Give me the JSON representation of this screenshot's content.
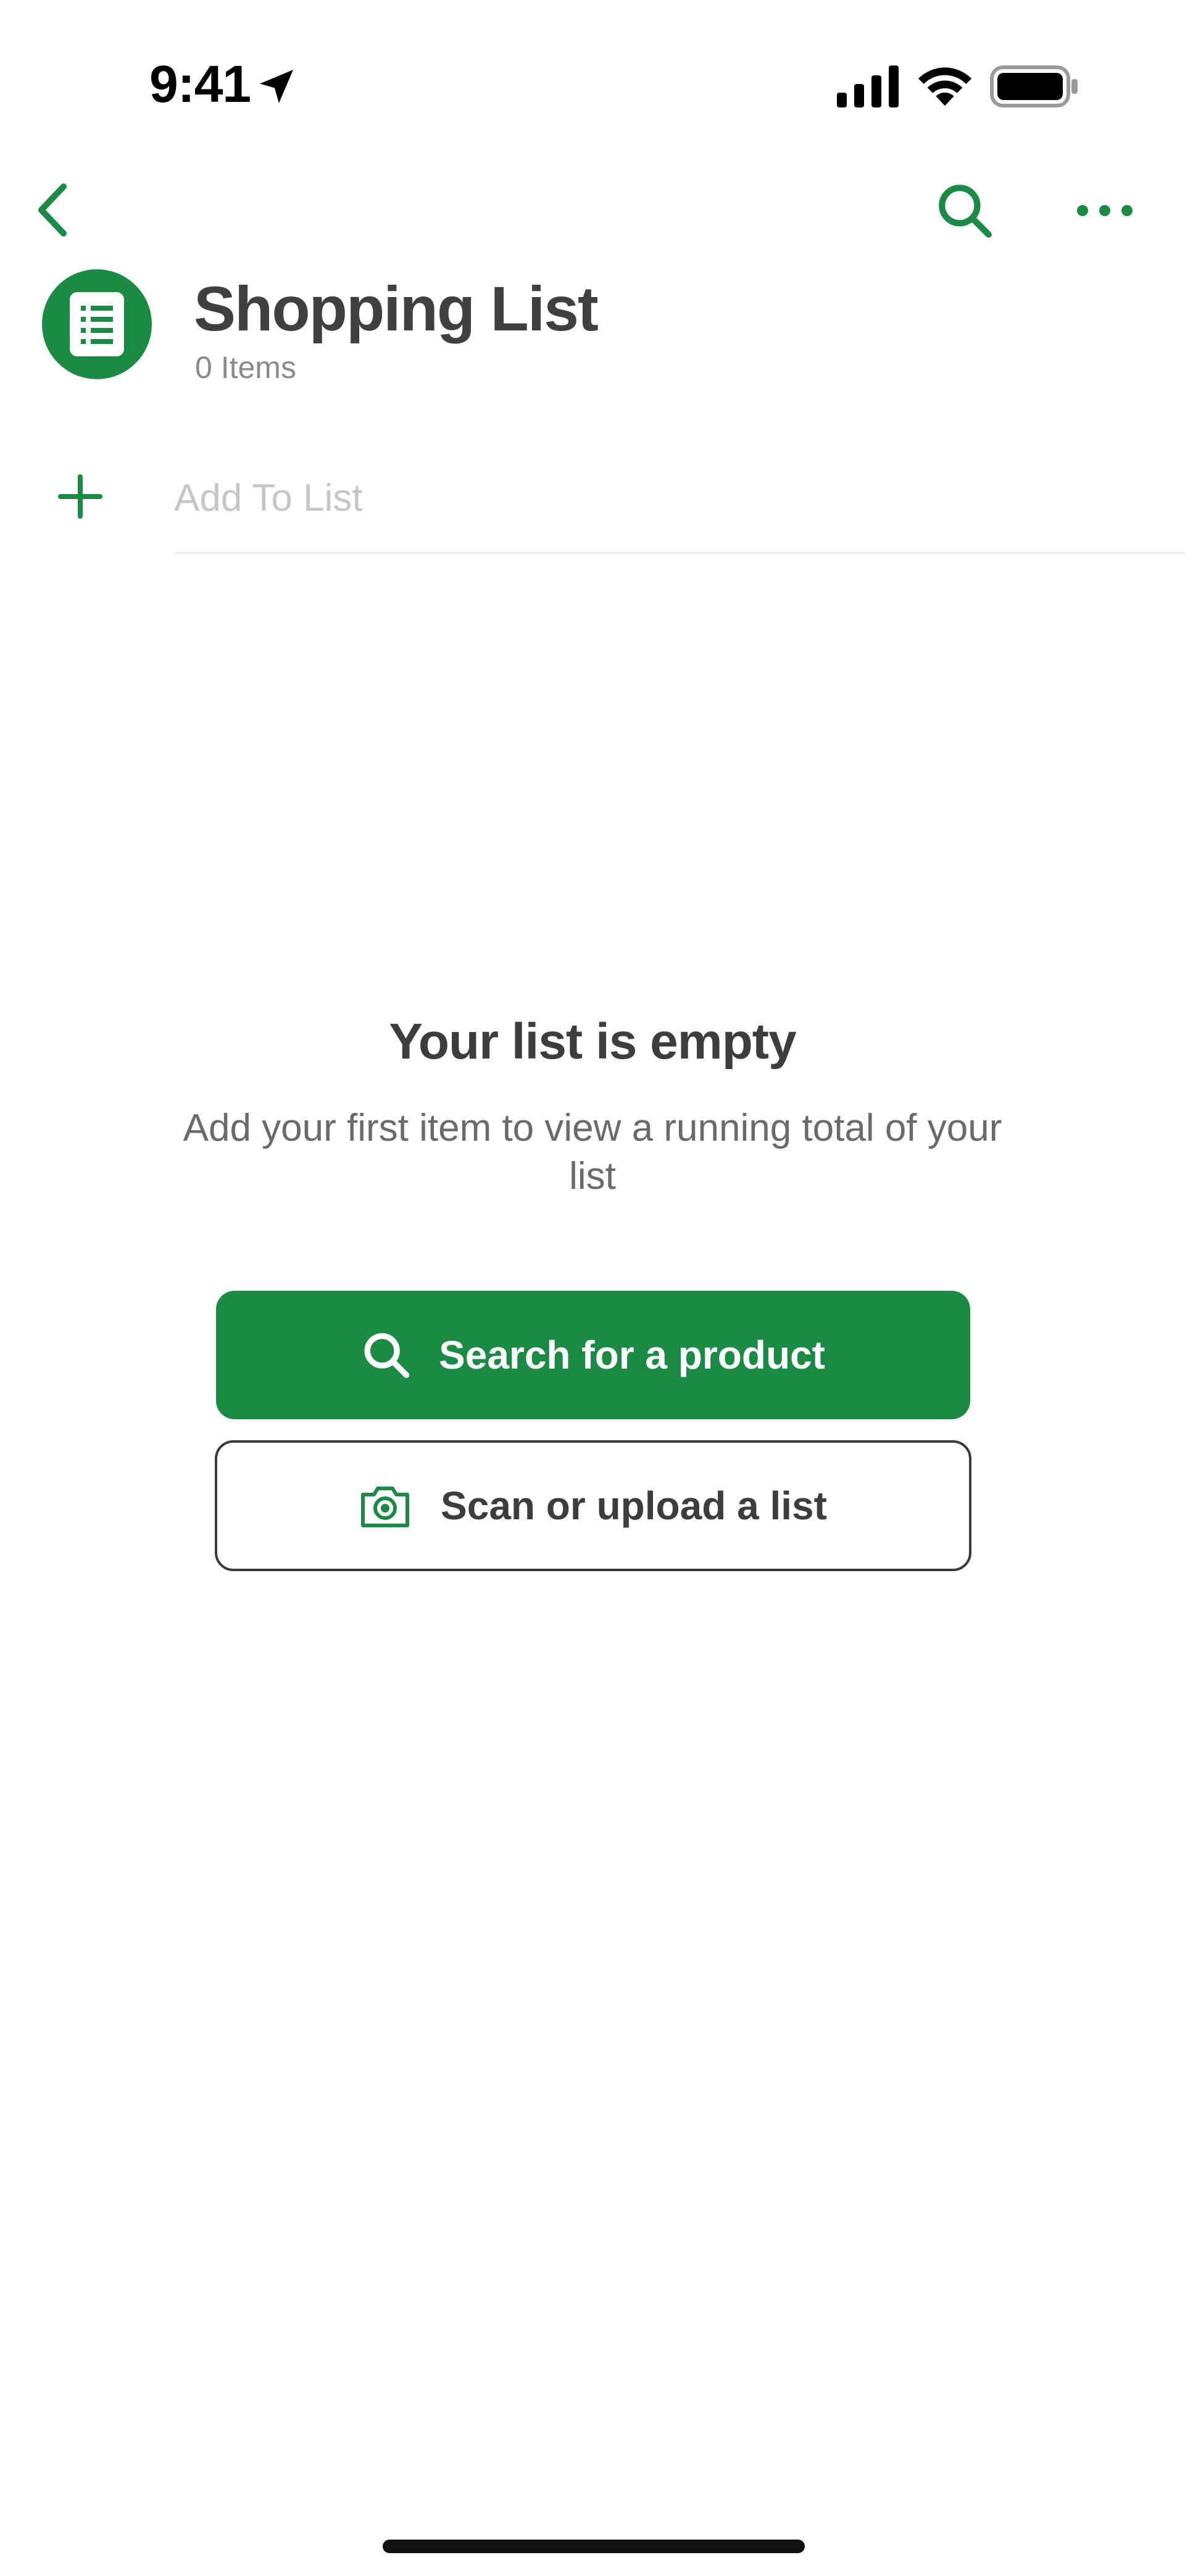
{
  "status_bar": {
    "time": "9:41",
    "icons": [
      "location-arrow-icon",
      "cellular-signal-icon",
      "wifi-icon",
      "battery-icon"
    ]
  },
  "nav": {
    "back_icon": "chevron-left-icon",
    "search_icon": "search-icon",
    "more_icon": "ellipsis-icon"
  },
  "header": {
    "avatar_icon": "list-document-icon",
    "title": "Shopping List",
    "item_count": "0 Items"
  },
  "add_to_list": {
    "icon": "plus-icon",
    "placeholder": "Add To List",
    "value": ""
  },
  "empty_state": {
    "title": "Your list is empty",
    "description": "Add your first item to view a running total of your list"
  },
  "actions": {
    "search_label": "Search for a product",
    "search_icon": "search-icon",
    "scan_label": "Scan or upload a list",
    "scan_icon": "camera-icon"
  },
  "colors": {
    "accent": "#1a8a44",
    "title_text": "#404040",
    "muted_text": "#8a8a8a",
    "placeholder_text": "#c6c6c6"
  }
}
